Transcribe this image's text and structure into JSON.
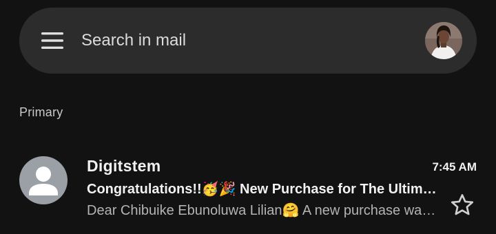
{
  "search": {
    "placeholder": "Search in mail"
  },
  "section": {
    "label": "Primary"
  },
  "emails": [
    {
      "sender": "Digitstem",
      "time": "7:45 AM",
      "subject": "Congratulations!!🥳🎉 New Purchase for The Ultimate Bundle",
      "snippet": "Dear Chibuike Ebunoluwa Lilian🤗 A new purchase was made",
      "starred": false
    }
  ],
  "colors": {
    "background": "#121212",
    "search_bar": "#2c2c2c",
    "sender_avatar": "#9aa0a6"
  },
  "icons": {
    "menu": "hamburger-menu-icon",
    "account": "account-avatar",
    "sender": "default-person-avatar-icon",
    "star": "star-outline-icon"
  }
}
